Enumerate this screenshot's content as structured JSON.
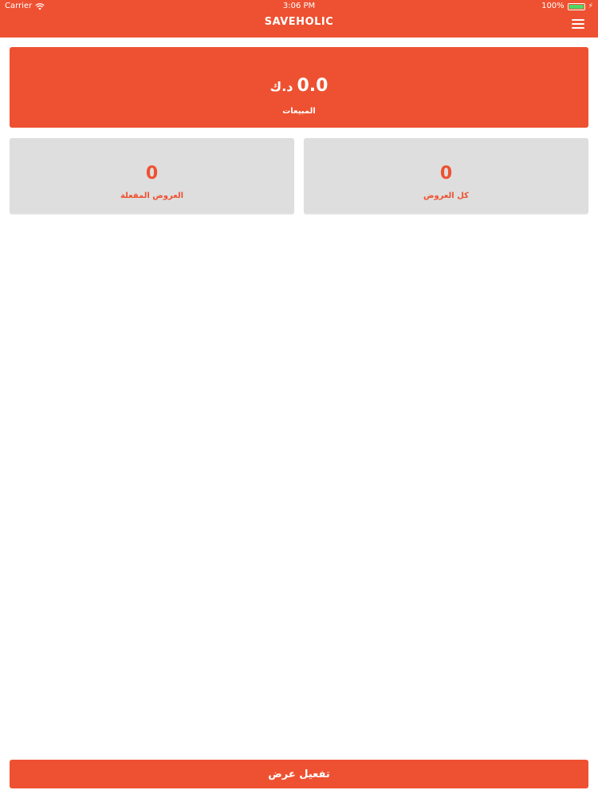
{
  "status_bar": {
    "carrier": "Carrier",
    "time": "3:06 PM",
    "battery": "100%"
  },
  "header": {
    "title": "SAVEHOLIC"
  },
  "sales_card": {
    "value": "0.0",
    "currency": "د.ك",
    "label": "المبيعات"
  },
  "stats": {
    "all_offers": {
      "value": "0",
      "label": "كل العروض"
    },
    "active_offers": {
      "value": "0",
      "label": "العروض المفعلة"
    }
  },
  "actions": {
    "activate_offer_label": "تفعيل عرض"
  },
  "colors": {
    "accent": "#ee5131",
    "card_gray": "#dedede",
    "battery_green": "#4cd964"
  }
}
